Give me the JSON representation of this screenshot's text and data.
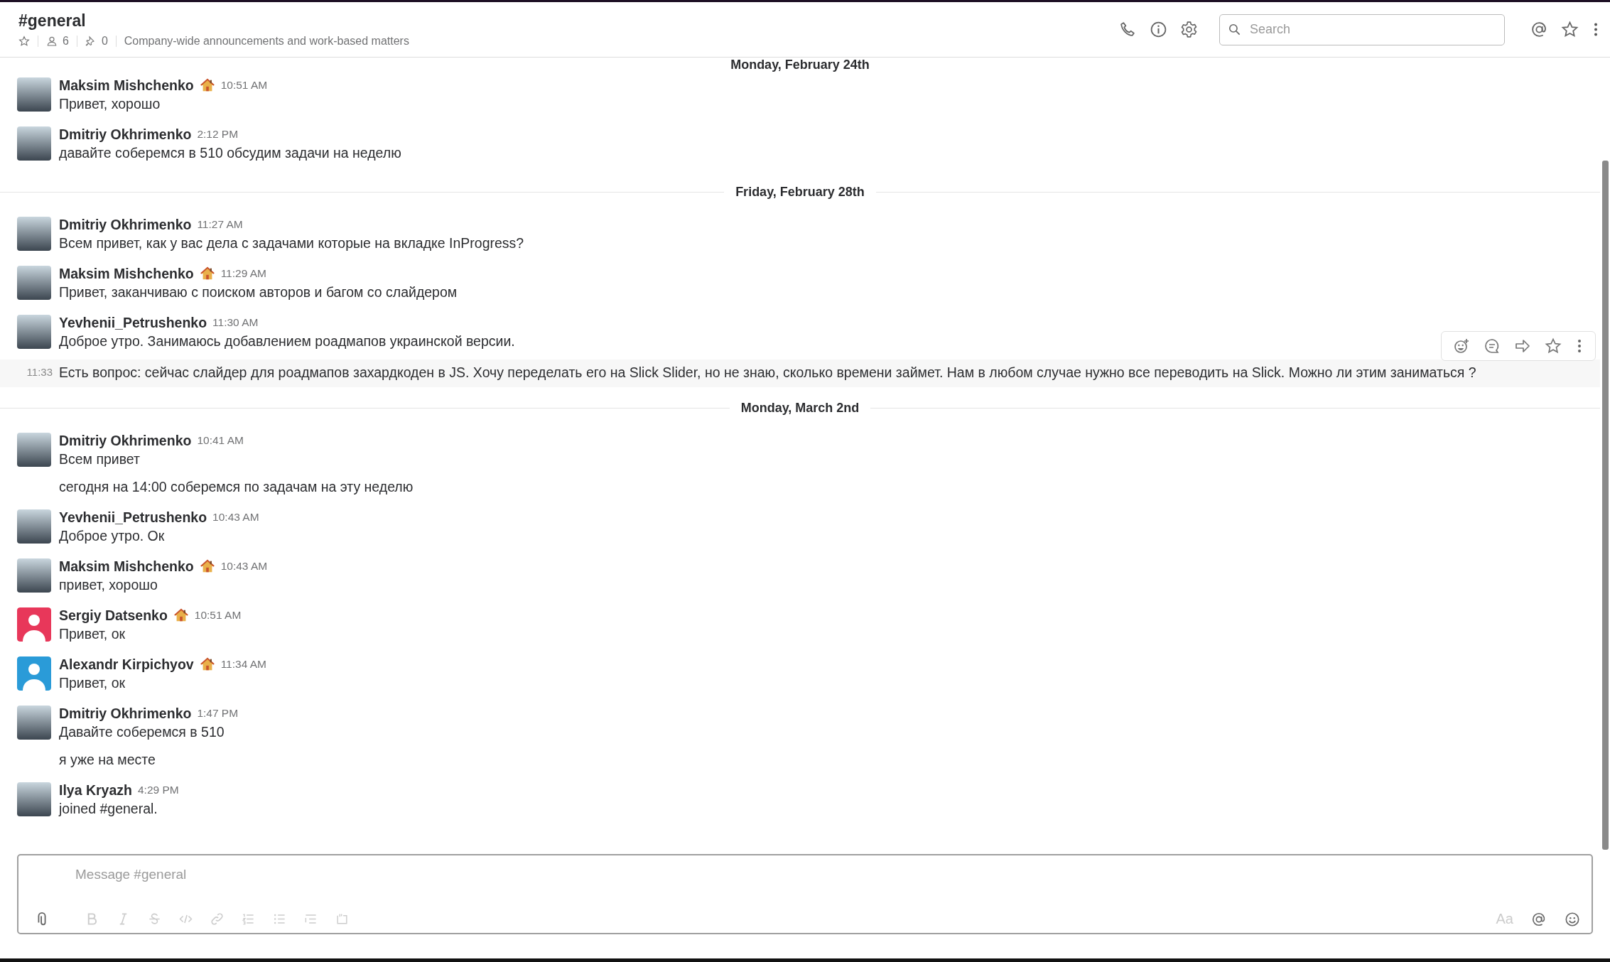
{
  "channel": {
    "name": "#general",
    "starred": false,
    "members": "6",
    "pins": "0",
    "topic": "Company-wide announcements and work-based matters"
  },
  "search": {
    "placeholder": "Search"
  },
  "sections": [
    {
      "date": "Monday, February 24th",
      "messages": [
        {
          "author": "Maksim Mishchenko",
          "status": true,
          "time": "10:51 AM",
          "avatar": {
            "kind": "photo"
          },
          "lines": [
            {
              "text": "Привет, хорошо",
              "hovered": false
            }
          ]
        },
        {
          "author": "Dmitriy Okhrimenko",
          "status": false,
          "time": "2:12 PM",
          "avatar": {
            "kind": "photo"
          },
          "lines": [
            {
              "text": "давайте соберемся в 510 обсудим задачи на неделю",
              "hovered": false
            }
          ]
        }
      ]
    },
    {
      "date": "Friday, February 28th",
      "messages": [
        {
          "author": "Dmitriy Okhrimenko",
          "status": false,
          "time": "11:27 AM",
          "avatar": {
            "kind": "photo"
          },
          "lines": [
            {
              "text": "Всем привет, как у вас дела с задачами которые на вкладке InProgress?",
              "hovered": false
            }
          ]
        },
        {
          "author": "Maksim Mishchenko",
          "status": true,
          "time": "11:29 AM",
          "avatar": {
            "kind": "photo"
          },
          "lines": [
            {
              "text": "Привет, заканчиваю с поиском авторов и багом со слайдером",
              "hovered": false
            }
          ]
        },
        {
          "author": "Yevhenii_Petrushenko",
          "status": false,
          "time": "11:30 AM",
          "avatar": {
            "kind": "photo"
          },
          "lines": [
            {
              "text": "Доброе утро. Занимаюсь добавлением роадмапов украинской версии.",
              "hovered": false
            },
            {
              "text": "Есть вопрос: сейчас слайдер для роадмапов захардкоден в JS. Хочу переделать его на Slick Slider, но не знаю, сколько времени займет. Нам в любом случае нужно все переводить на Slick. Можно ли этим заниматься ?",
              "hovered": true,
              "time": "11:33"
            }
          ]
        }
      ]
    },
    {
      "date": "Monday, March 2nd",
      "messages": [
        {
          "author": "Dmitriy Okhrimenko",
          "status": false,
          "time": "10:41 AM",
          "avatar": {
            "kind": "photo"
          },
          "lines": [
            {
              "text": "Всем привет",
              "hovered": false
            },
            {
              "text": "сегодня на 14:00 соберемся по задачам на эту неделю",
              "hovered": false
            }
          ]
        },
        {
          "author": "Yevhenii_Petrushenko",
          "status": false,
          "time": "10:43 AM",
          "avatar": {
            "kind": "photo"
          },
          "lines": [
            {
              "text": "Доброе утро. Ок",
              "hovered": false
            }
          ]
        },
        {
          "author": "Maksim Mishchenko",
          "status": true,
          "time": "10:43 AM",
          "avatar": {
            "kind": "photo"
          },
          "lines": [
            {
              "text": "привет, хорошо",
              "hovered": false
            }
          ]
        },
        {
          "author": "Sergiy Datsenko",
          "status": true,
          "time": "10:51 AM",
          "avatar": {
            "kind": "silhouette",
            "color": "#e8375a"
          },
          "lines": [
            {
              "text": "Привет, ок",
              "hovered": false
            }
          ]
        },
        {
          "author": "Alexandr Kirpichyov",
          "status": true,
          "time": "11:34 AM",
          "avatar": {
            "kind": "silhouette",
            "color": "#2a9bd8"
          },
          "lines": [
            {
              "text": "Привет, ок",
              "hovered": false
            }
          ]
        },
        {
          "author": "Dmitriy Okhrimenko",
          "status": false,
          "time": "1:47 PM",
          "avatar": {
            "kind": "photo"
          },
          "lines": [
            {
              "text": "Давайте соберемся в 510",
              "hovered": false
            },
            {
              "text": "я уже на месте",
              "hovered": false
            }
          ]
        },
        {
          "author": "Ilya Kryazh",
          "status": false,
          "time": "4:29 PM",
          "avatar": {
            "kind": "photo"
          },
          "lines": [
            {
              "text": "joined #general.",
              "hovered": false
            }
          ]
        }
      ]
    }
  ],
  "composer": {
    "placeholder": "Message #general",
    "format_toggle": "Aa"
  }
}
